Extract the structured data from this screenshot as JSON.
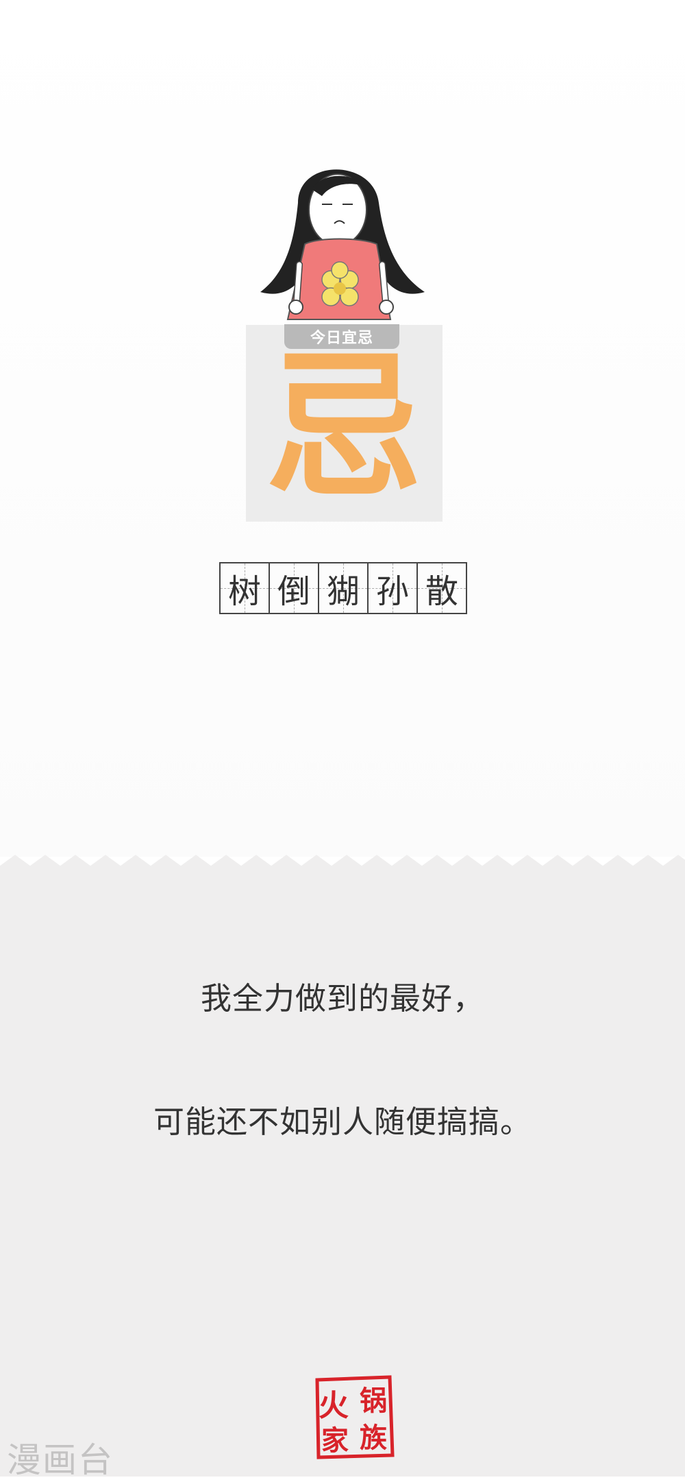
{
  "card": {
    "tag": "今日宜忌",
    "main_char": "忌"
  },
  "grid": [
    "树",
    "倒",
    "猢",
    "孙",
    "散"
  ],
  "text": {
    "line1": "我全力做到的最好，",
    "line2": "可能还不如别人随便搞搞。"
  },
  "seal": {
    "chars": [
      "火",
      "锅",
      "家",
      "族"
    ],
    "color": "#d8232a"
  },
  "watermark": "漫画台",
  "colors": {
    "accent": "#f5ae5d",
    "dress": "#f07a7a",
    "bottom_bg": "#efeeee"
  }
}
